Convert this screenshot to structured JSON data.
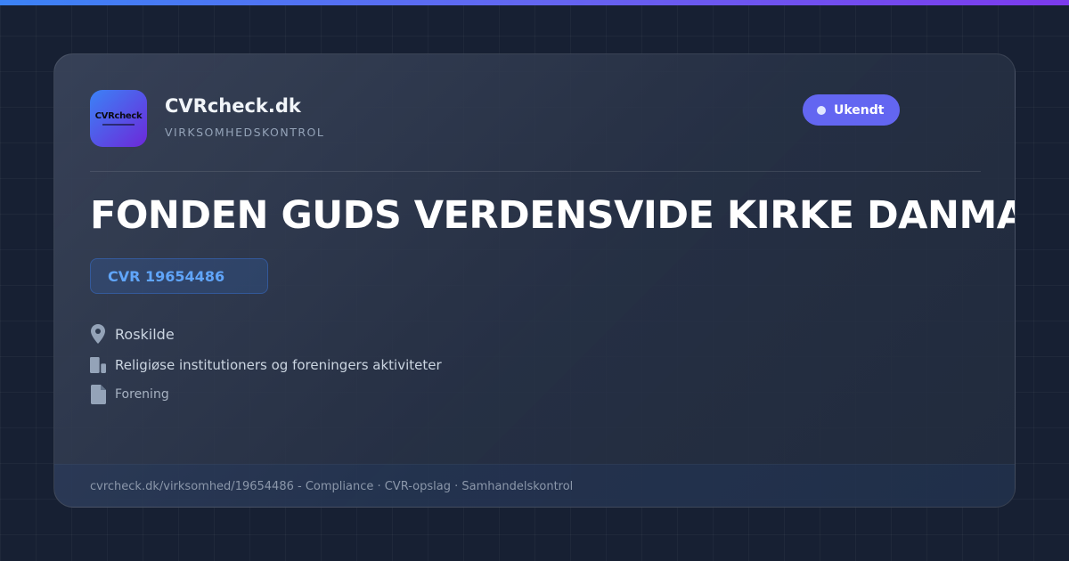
{
  "brand": {
    "logo_text": "CVRcheck",
    "name": "CVRcheck.dk",
    "tagline": "VIRKSOMHEDSKONTROL"
  },
  "status": {
    "label": "Ukendt",
    "color": "#6366f1"
  },
  "company": {
    "name": "FONDEN GUDS VERDENSVIDE KIRKE DANMARK",
    "cvr": "CVR 19654486"
  },
  "details": [
    {
      "icon": "location-pin-icon",
      "text": "Roskilde"
    },
    {
      "icon": "building-icon",
      "text": "Religiøse institutioners og foreningers aktiviteter"
    },
    {
      "icon": "document-icon",
      "text": "Forening"
    }
  ],
  "footer": {
    "text": "cvrcheck.dk/virksomhed/19654486 - Compliance · CVR-opslag · Samhandelskontrol"
  },
  "colors": {
    "accent": "#6366f1",
    "cvr_text": "#60a5fa",
    "background": "#172033"
  }
}
